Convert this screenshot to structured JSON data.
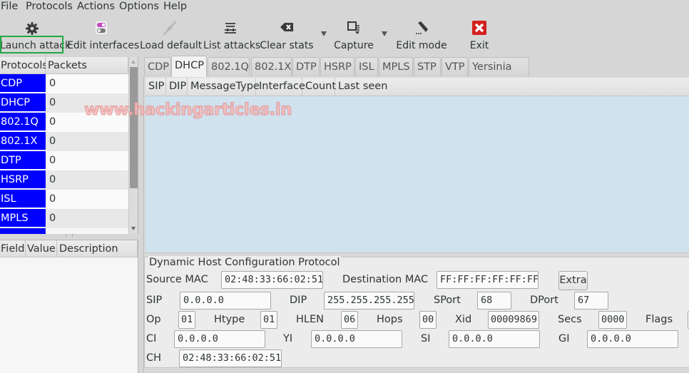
{
  "menu": [
    "File",
    "Protocols",
    "Actions",
    "Options",
    "Help"
  ],
  "toolbar": {
    "launch_attack": "Launch attack",
    "edit_interfaces": "Edit interfaces",
    "load_default": "Load default",
    "list_attacks": "List attacks",
    "clear_stats": "Clear stats",
    "capture": "Capture",
    "edit_mode": "Edit mode",
    "exit": "Exit",
    "highlight_color": "#22a843"
  },
  "protocols_table": {
    "headers": [
      "Protocols",
      "Packets"
    ],
    "rows": [
      {
        "name": "CDP",
        "packets": "0"
      },
      {
        "name": "DHCP",
        "packets": "0"
      },
      {
        "name": "802.1Q",
        "packets": "0"
      },
      {
        "name": "802.1X",
        "packets": "0"
      },
      {
        "name": "DTP",
        "packets": "0"
      },
      {
        "name": "HSRP",
        "packets": "0"
      },
      {
        "name": "ISL",
        "packets": "0"
      },
      {
        "name": "MPLS",
        "packets": "0"
      }
    ],
    "name_bg_color": "#0000ff"
  },
  "field_table": {
    "headers": [
      "Field",
      "Value",
      "Description"
    ]
  },
  "tabs": [
    "CDP",
    "DHCP",
    "802.1Q",
    "802.1X",
    "DTP",
    "HSRP",
    "ISL",
    "MPLS",
    "STP",
    "VTP",
    "Yersinia log"
  ],
  "active_tab": "DHCP",
  "packet_list": {
    "headers": [
      "SIP",
      "DIP",
      "MessageType",
      "Interface",
      "Count",
      "Last seen"
    ]
  },
  "watermark": "www.hackingarticles.in",
  "dhcp": {
    "title": "Dynamic Host Configuration Protocol",
    "source_mac_label": "Source MAC",
    "source_mac": "02:48:33:66:02:51",
    "dest_mac_label": "Destination MAC",
    "dest_mac": "FF:FF:FF:FF:FF:FF",
    "extra_button": "Extra",
    "sip_label": "SIP",
    "sip": "0.0.0.0",
    "dip_label": "DIP",
    "dip": "255.255.255.255",
    "sport_label": "SPort",
    "sport": "68",
    "dport_label": "DPort",
    "dport": "67",
    "op_label": "Op",
    "op": "01",
    "htype_label": "Htype",
    "htype": "01",
    "hlen_label": "HLEN",
    "hlen": "06",
    "hops_label": "Hops",
    "hops": "00",
    "xid_label": "Xid",
    "xid": "00009869",
    "secs_label": "Secs",
    "secs": "0000",
    "flags_label": "Flags",
    "ci_label": "CI",
    "ci": "0.0.0.0",
    "yi_label": "YI",
    "yi": "0.0.0.0",
    "si_label": "SI",
    "si": "0.0.0.0",
    "gi_label": "GI",
    "gi": "0.0.0.0",
    "ch_label": "CH",
    "ch": "02:48:33:66:02:51"
  }
}
